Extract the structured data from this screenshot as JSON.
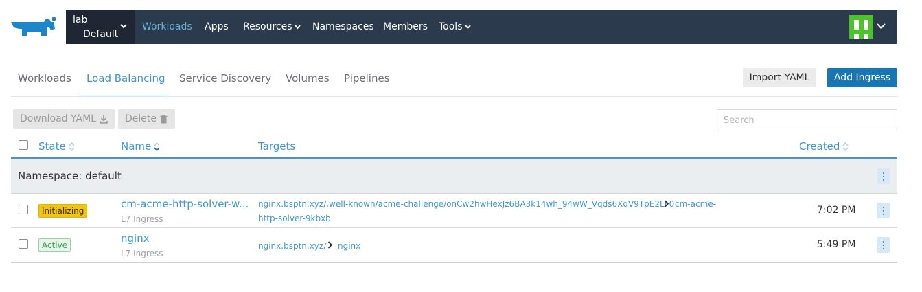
{
  "header": {
    "cluster_name": "lab",
    "project_name": "Default",
    "nav": [
      {
        "label": "Workloads",
        "active": true,
        "dropdown": false
      },
      {
        "label": "Apps",
        "active": false,
        "dropdown": false
      },
      {
        "label": "Resources",
        "active": false,
        "dropdown": true
      },
      {
        "label": "Namespaces",
        "active": false,
        "dropdown": false
      },
      {
        "label": "Members",
        "active": false,
        "dropdown": false
      },
      {
        "label": "Tools",
        "active": false,
        "dropdown": true
      }
    ],
    "icons": {
      "logo": "rancher-logo",
      "avatar": "user-avatar-identicon",
      "chevron": "chevron-down-icon"
    }
  },
  "tabs": [
    {
      "label": "Workloads",
      "active": false
    },
    {
      "label": "Load Balancing",
      "active": true
    },
    {
      "label": "Service Discovery",
      "active": false
    },
    {
      "label": "Volumes",
      "active": false
    },
    {
      "label": "Pipelines",
      "active": false
    }
  ],
  "actions": {
    "import_yaml": "Import YAML",
    "add_ingress": "Add Ingress",
    "download_yaml": "Download YAML",
    "delete": "Delete"
  },
  "search": {
    "placeholder": "Search"
  },
  "table": {
    "columns": {
      "state": "State",
      "name": "Name",
      "targets": "Targets",
      "created": "Created"
    },
    "group_label": "Namespace: default",
    "rows": [
      {
        "state": "Initializing",
        "state_color": "#f1c40f",
        "name": "cm-acme-http-solver-w...",
        "type": "L7 Ingress",
        "target_path": "nginx.bsptn.xyz/.well-known/acme-challenge/onCw2hwHexJz6BA3k14wh_94wW_Vqds6XqV9TpE2LF0",
        "target_service_line1": "cm-acme-",
        "target_service_line2": "http-solver-9kbxb",
        "created": "7:02 PM"
      },
      {
        "state": "Active",
        "state_color": "#3b9f52",
        "name": "nginx",
        "type": "L7 Ingress",
        "target_path": "nginx.bsptn.xyz/",
        "target_service": "nginx",
        "created": "5:49 PM"
      }
    ]
  },
  "colors": {
    "topbar": "#2b3a4d",
    "accent": "#3d98d3",
    "primary_button": "#1976b5"
  }
}
